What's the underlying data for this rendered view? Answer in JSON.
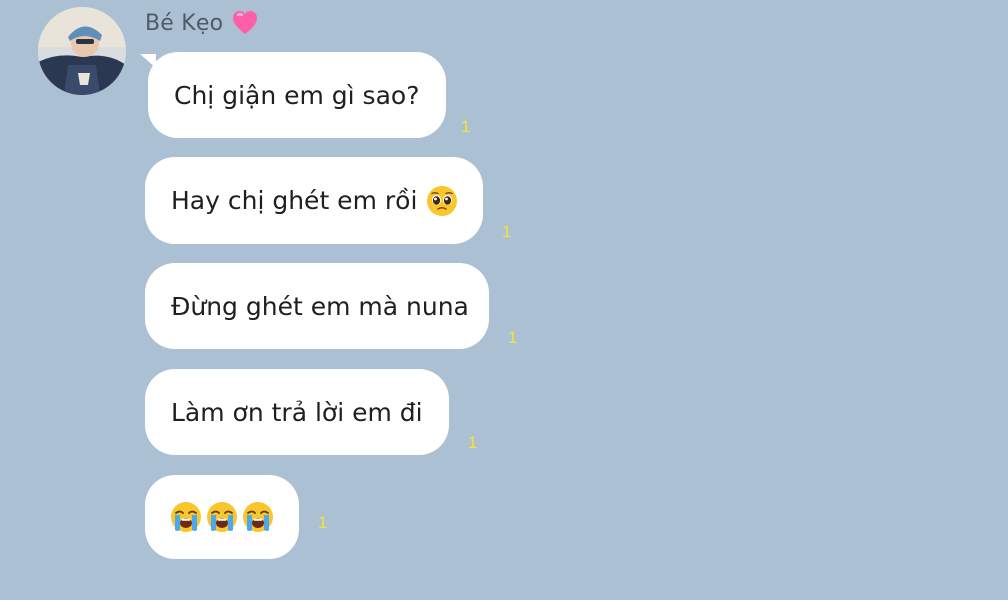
{
  "sender": {
    "name": "Bé Kẹo",
    "badge_icon": "pink-heart-icon"
  },
  "messages": [
    {
      "text": "Chị giận em gì sao?",
      "unread_count": "1"
    },
    {
      "text": "Hay chị ghét em rồi",
      "emoji": "pleading-face-icon",
      "unread_count": "1"
    },
    {
      "text": "Đừng ghét em mà nuna",
      "unread_count": "1"
    },
    {
      "text": "Làm ơn trả lời em đi",
      "unread_count": "1"
    },
    {
      "emojis": [
        "loudly-crying-face-icon",
        "loudly-crying-face-icon",
        "loudly-crying-face-icon"
      ],
      "unread_count": "1"
    }
  ],
  "colors": {
    "background": "#abc1d3",
    "bubble": "#ffffff",
    "unread": "#f5e33a",
    "sender_name": "#4f5b66"
  }
}
